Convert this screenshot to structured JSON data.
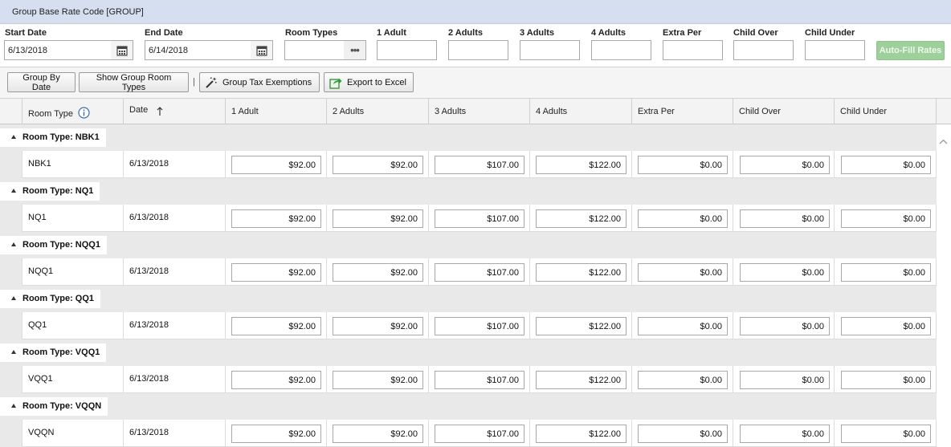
{
  "title": "Group Base Rate Code [GROUP]",
  "filters": {
    "start_date_label": "Start Date",
    "start_date_value": "6/13/2018",
    "end_date_label": "End Date",
    "end_date_value": "6/14/2018",
    "room_types_label": "Room Types",
    "room_types_value": "",
    "one_adult_label": "1 Adult",
    "two_adults_label": "2 Adults",
    "three_adults_label": "3 Adults",
    "four_adults_label": "4 Adults",
    "extra_per_label": "Extra Per",
    "child_over_label": "Child Over",
    "child_under_label": "Child Under",
    "auto_fill_label": "Auto-Fill Rates"
  },
  "toolbar": {
    "group_by_date": "Group By Date",
    "show_group_room_types": "Show Group Room Types",
    "separator": "|",
    "group_tax_exemptions": "Group Tax Exemptions",
    "export_to_excel": "Export to Excel"
  },
  "columns": {
    "room_type": "Room Type",
    "date": "Date",
    "one_adult": "1 Adult",
    "two_adults": "2 Adults",
    "three_adults": "3 Adults",
    "four_adults": "4 Adults",
    "extra_per": "Extra Per",
    "child_over": "Child Over",
    "child_under": "Child Under"
  },
  "groups": [
    {
      "label": "Room Type: NBK1",
      "room": "NBK1",
      "date": "6/13/2018",
      "rates": [
        "$92.00",
        "$92.00",
        "$107.00",
        "$122.00",
        "$0.00",
        "$0.00",
        "$0.00"
      ]
    },
    {
      "label": "Room Type: NQ1",
      "room": "NQ1",
      "date": "6/13/2018",
      "rates": [
        "$92.00",
        "$92.00",
        "$107.00",
        "$122.00",
        "$0.00",
        "$0.00",
        "$0.00"
      ]
    },
    {
      "label": "Room Type: NQQ1",
      "room": "NQQ1",
      "date": "6/13/2018",
      "rates": [
        "$92.00",
        "$92.00",
        "$107.00",
        "$122.00",
        "$0.00",
        "$0.00",
        "$0.00"
      ]
    },
    {
      "label": "Room Type: QQ1",
      "room": "QQ1",
      "date": "6/13/2018",
      "rates": [
        "$92.00",
        "$92.00",
        "$107.00",
        "$122.00",
        "$0.00",
        "$0.00",
        "$0.00"
      ]
    },
    {
      "label": "Room Type: VQQ1",
      "room": "VQQ1",
      "date": "6/13/2018",
      "rates": [
        "$92.00",
        "$92.00",
        "$107.00",
        "$122.00",
        "$0.00",
        "$0.00",
        "$0.00"
      ]
    },
    {
      "label": "Room Type: VQQN",
      "room": "VQQN",
      "date": "6/13/2018",
      "rates": [
        "$92.00",
        "$92.00",
        "$107.00",
        "$122.00",
        "$0.00",
        "$0.00",
        "$0.00"
      ]
    }
  ]
}
